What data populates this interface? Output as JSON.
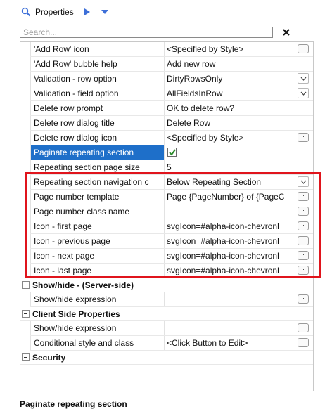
{
  "toolbar": {
    "properties_label": "Properties",
    "icons": [
      "search-properties-icon",
      "play-icon",
      "dropdown-triangle-icon"
    ]
  },
  "search": {
    "placeholder": "Search...",
    "clear_label": "✕"
  },
  "rows": [
    {
      "name": "'Add Row' icon",
      "value": "<Specified by Style>",
      "control": "ellipsis"
    },
    {
      "name": "'Add Row' bubble help",
      "value": "Add new row",
      "control": "none"
    },
    {
      "name": "Validation - row option",
      "value": "DirtyRowsOnly",
      "control": "dropdown"
    },
    {
      "name": "Validation - field option",
      "value": "AllFieldsInRow",
      "control": "dropdown"
    },
    {
      "name": "Delete row prompt",
      "value": "OK to delete row?",
      "control": "none"
    },
    {
      "name": "Delete row dialog title",
      "value": "Delete Row",
      "control": "none"
    },
    {
      "name": "Delete row dialog icon",
      "value": "<Specified by Style>",
      "control": "ellipsis"
    },
    {
      "name": "Paginate repeating section",
      "value": "",
      "control": "checkbox",
      "checked": true,
      "selected": true
    },
    {
      "name": "Repeating section page size",
      "value": "5",
      "control": "none"
    },
    {
      "name": "Repeating section navigation c",
      "value": "Below Repeating Section",
      "control": "dropdown"
    },
    {
      "name": "Page number template",
      "value": "Page {PageNumber} of {PageC",
      "control": "ellipsis"
    },
    {
      "name": "Page number class name",
      "value": "",
      "control": "ellipsis"
    },
    {
      "name": "Icon - first page",
      "value": "svgIcon=#alpha-icon-chevronl",
      "control": "ellipsis"
    },
    {
      "name": "Icon - previous page",
      "value": "svgIcon=#alpha-icon-chevronl",
      "control": "ellipsis"
    },
    {
      "name": "Icon - next page",
      "value": "svgIcon=#alpha-icon-chevronl",
      "control": "ellipsis"
    },
    {
      "name": "Icon - last page",
      "value": "svgIcon=#alpha-icon-chevronl",
      "control": "ellipsis"
    }
  ],
  "groups": {
    "show_hide": {
      "label": "Show/hide - (Server-side)",
      "rows": [
        {
          "name": "Show/hide expression",
          "value": "",
          "control": "ellipsis"
        }
      ]
    },
    "client_side": {
      "label": "Client Side Properties",
      "rows": [
        {
          "name": "Show/hide expression",
          "value": "",
          "control": "ellipsis"
        },
        {
          "name": "Conditional style and class",
          "value": "<Click Button to Edit>",
          "control": "ellipsis"
        }
      ]
    },
    "security": {
      "label": "Security"
    }
  },
  "description": "Paginate repeating section",
  "colors": {
    "selection": "#1e6fc9",
    "highlight_border": "#e0141c",
    "checkbox_check": "#2a8a2a",
    "icon_accent": "#3d6fd8"
  }
}
